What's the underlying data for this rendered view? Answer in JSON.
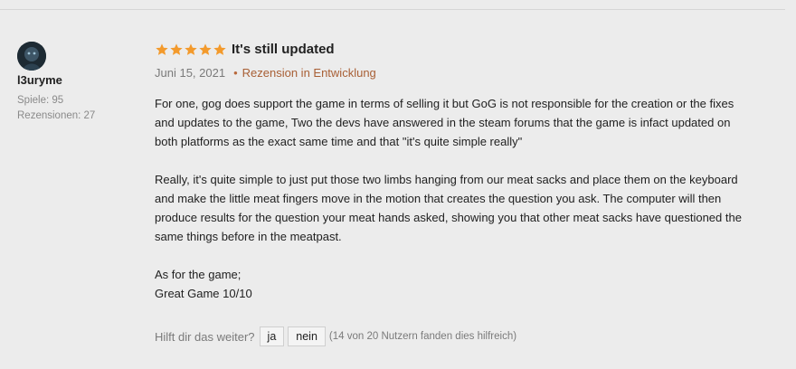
{
  "reviewer": {
    "username": "l3uryme",
    "games": "Spiele: 95",
    "reviews": "Rezensionen: 27"
  },
  "review": {
    "rating": 5,
    "title": "It's still updated",
    "date": "Juni 15, 2021",
    "status": "Rezension in Entwicklung",
    "paragraphs": [
      "For one, gog does support the game in terms of selling it but GoG is not responsible for the creation or the fixes and updates to the game, Two the devs have answered in the steam forums that the game is infact updated on both platforms as the exact same time and that \"it's quite simple really\"",
      "Really, it's quite simple to just put those two limbs hanging from our meat sacks and place them on the keyboard and make the little meat fingers move in the motion that creates the question you ask. The computer will then produce results for the question your meat hands asked, showing you that other meat sacks have questioned the same things before in the meatpast.",
      "As for the game;\nGreat Game 10/10"
    ]
  },
  "helpful": {
    "question": "Hilft dir das weiter?",
    "yes_label": "ja",
    "no_label": "nein",
    "count_text": "(14 von 20 Nutzern fanden dies hilfreich)"
  },
  "colors": {
    "star": "#f39a2c",
    "accent": "#a85f35"
  }
}
